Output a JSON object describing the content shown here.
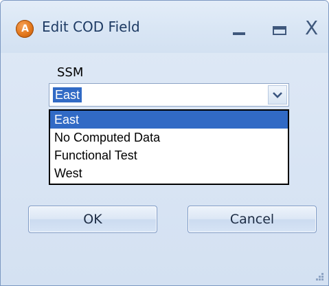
{
  "window": {
    "title": "Edit COD Field",
    "icon_label": "A"
  },
  "titlebar_buttons": {
    "minimize_icon": "minimize-icon",
    "maximize_icon": "maximize-icon",
    "close_glyph": "X"
  },
  "form": {
    "field_label": "SSM",
    "combo_value": "East",
    "options": [
      {
        "label": "East",
        "selected": true
      },
      {
        "label": "No Computed Data",
        "selected": false
      },
      {
        "label": "Functional Test",
        "selected": false
      },
      {
        "label": "West",
        "selected": false
      }
    ]
  },
  "buttons": {
    "ok_label": "OK",
    "cancel_label": "Cancel"
  },
  "colors": {
    "selection": "#316ac5",
    "title_text": "#1d3a63",
    "window_bg": "#d4e1f2"
  }
}
